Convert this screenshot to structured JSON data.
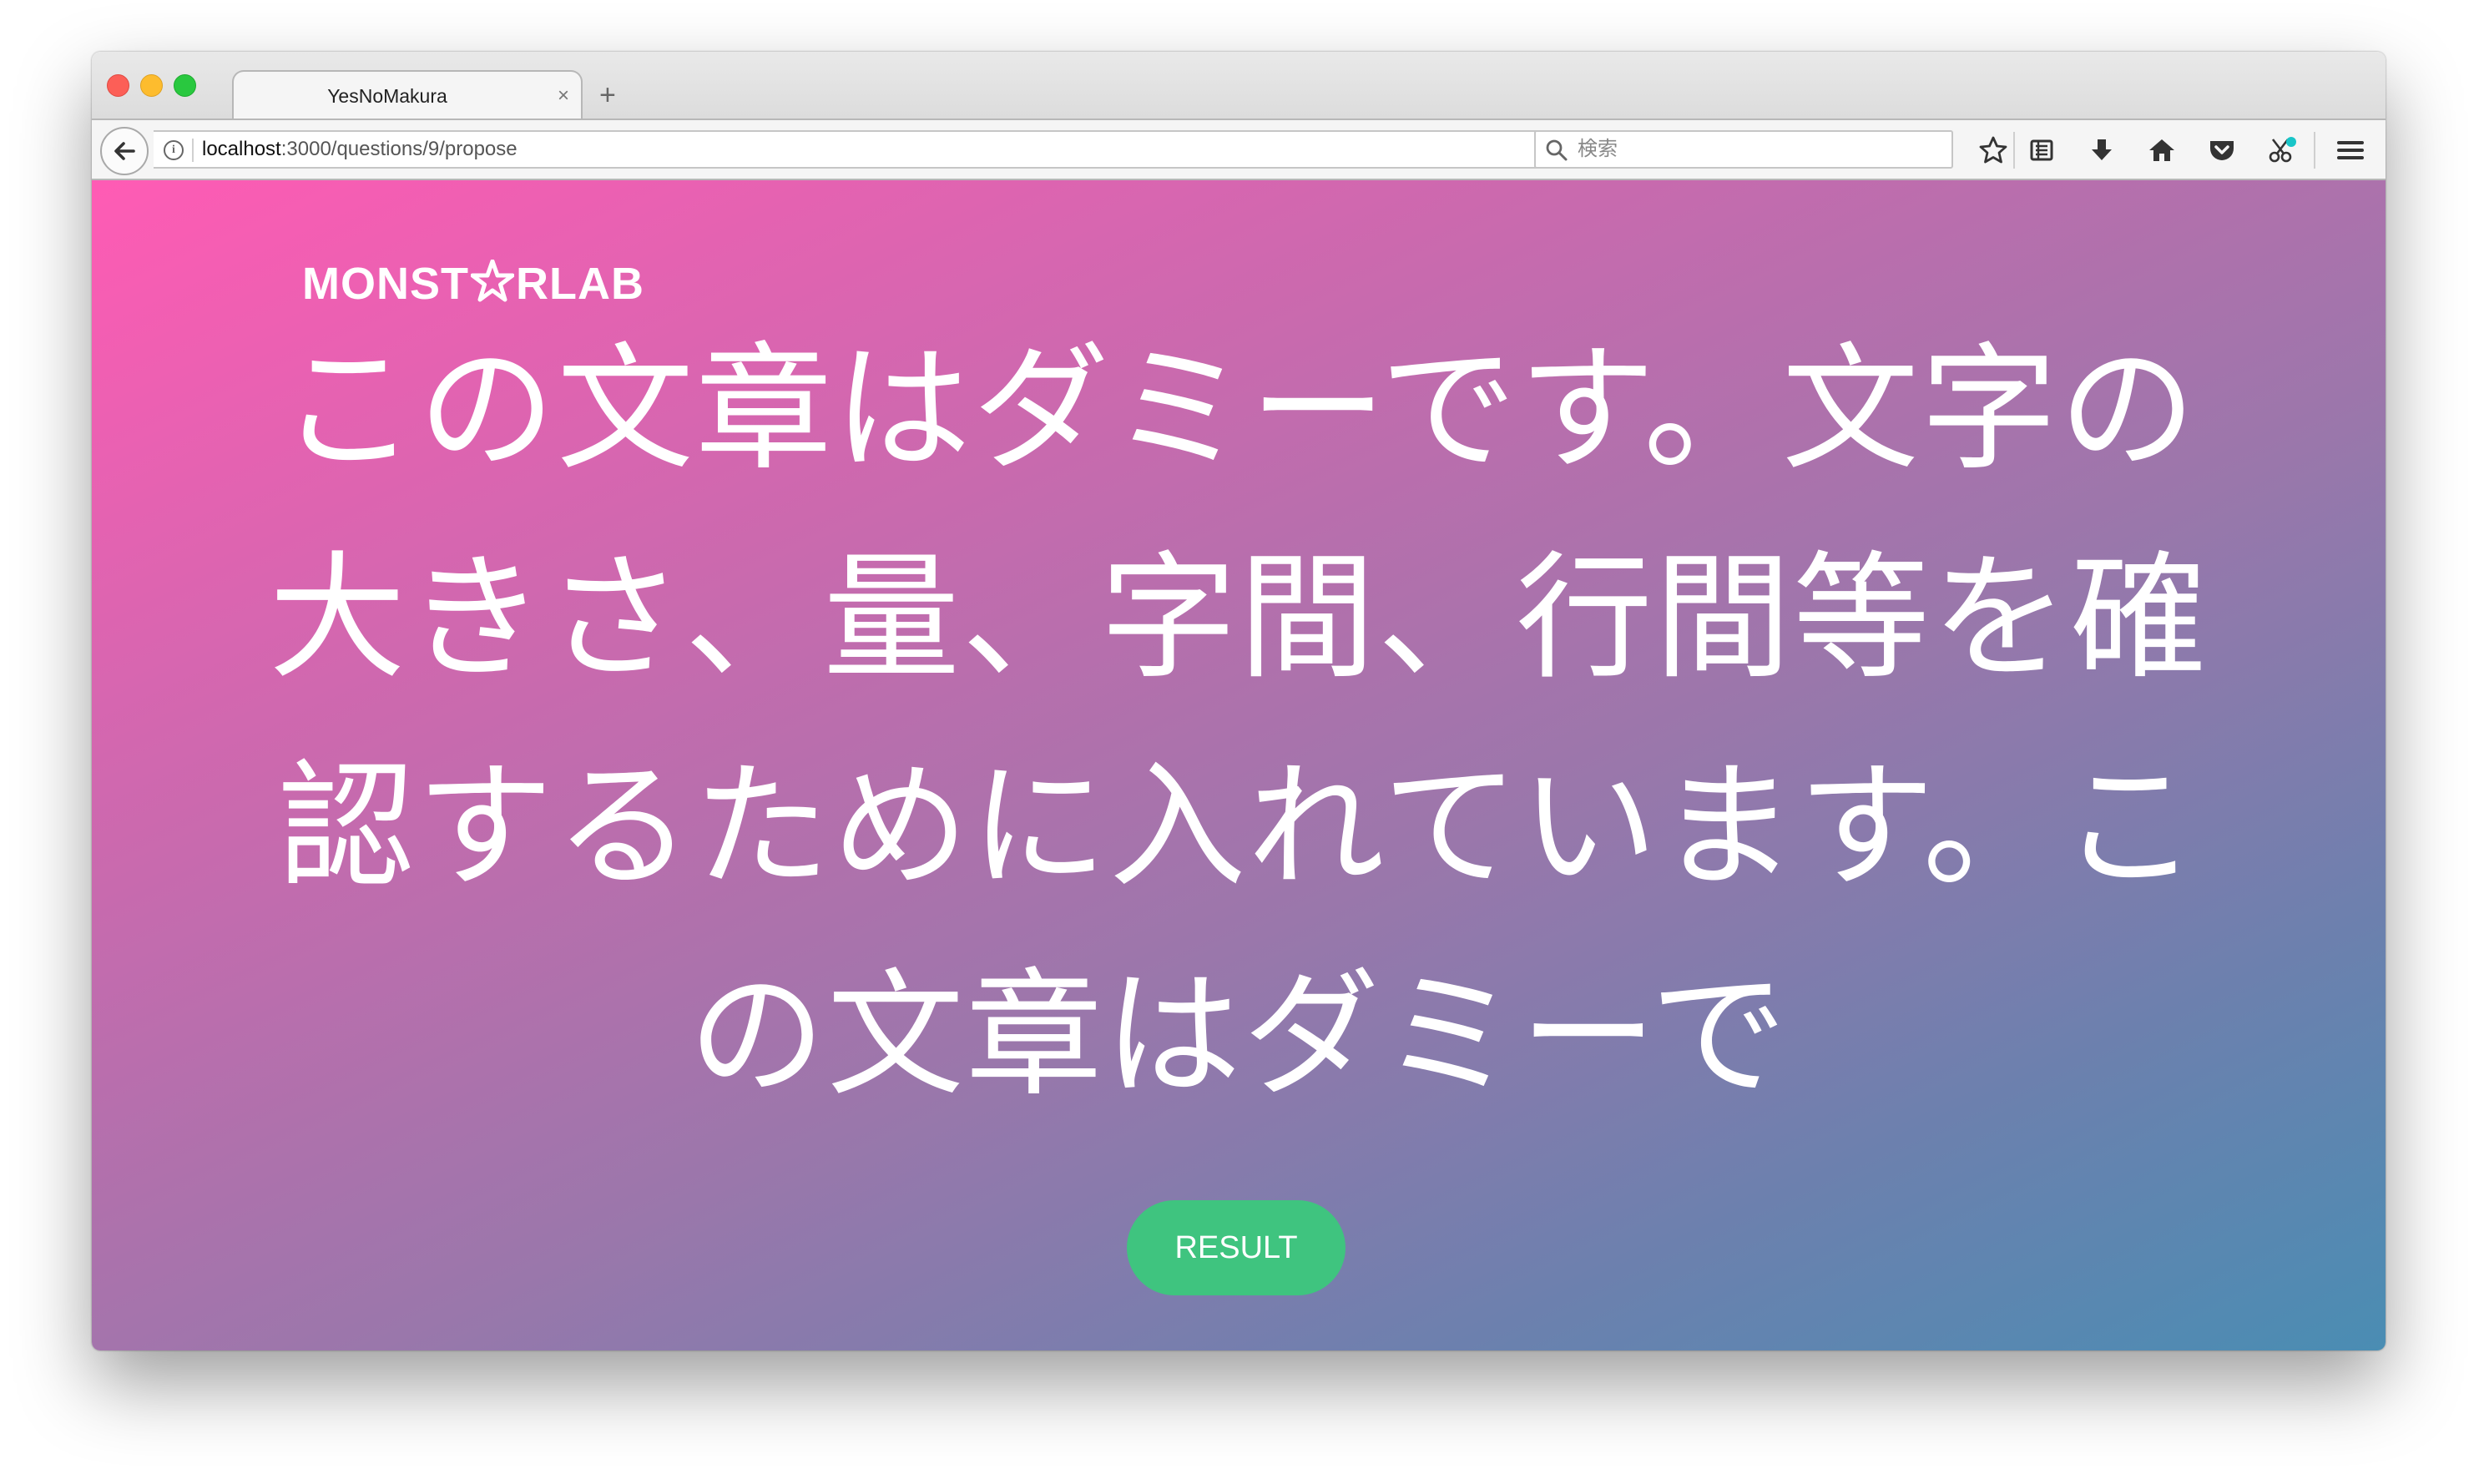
{
  "browser": {
    "tab": {
      "title": "YesNoMakura",
      "close_glyph": "×"
    },
    "new_tab_glyph": "+",
    "url": {
      "host": "localhost",
      "path": ":3000/questions/9/propose"
    },
    "search": {
      "placeholder": "検索"
    },
    "toolbar_icons": [
      "bookmark-star-icon",
      "reading-list-icon",
      "download-icon",
      "home-icon",
      "pocket-icon",
      "extension-icon",
      "hamburger-menu-icon"
    ]
  },
  "page": {
    "logo": {
      "left": "MONST",
      "right": "RLAB"
    },
    "headline": "この文章はダミーです。文字の大きさ、量、字間、行間等を確認するために入れています。この文章はダミーで",
    "result_button": "RESULT",
    "colors": {
      "gradient_start": "#ff5bb4",
      "gradient_end": "#4a8db3",
      "button": "#3fc47f"
    }
  }
}
